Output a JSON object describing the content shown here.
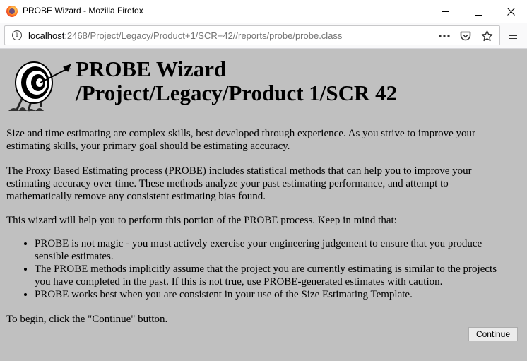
{
  "window": {
    "title": "PROBE Wizard - Mozilla Firefox",
    "minimize_glyph": "—",
    "maximize_glyph": "☐",
    "close_glyph": "✕"
  },
  "toolbar": {
    "url_host": "localhost",
    "url_path": ":2468/Project/Legacy/Product+1/SCR+42//reports/probe/probe.class",
    "page_actions": [
      "ellipsis-icon",
      "pocket-icon",
      "bookmark-star-icon"
    ],
    "menu": "hamburger-menu-icon"
  },
  "page": {
    "heading_line1": "PROBE Wizard",
    "heading_line2": "/Project/Legacy/Product 1/SCR 42",
    "para1": "Size and time estimating are complex skills, best developed through experience. As you strive to improve your estimating skills, your primary goal should be estimating accuracy.",
    "para2": "The Proxy Based Estimating process (PROBE) includes statistical methods that can help you to improve your estimating accuracy over time. These methods analyze your past estimating performance, and attempt to mathematically remove any consistent estimating bias found.",
    "para3": "This wizard will help you to perform this portion of the PROBE process. Keep in mind that:",
    "bullets": [
      "PROBE is not magic - you must actively exercise your engineering judgement to ensure that you produce sensible estimates.",
      "The PROBE methods implicitly assume that the project you are currently estimating is similar to the projects you have completed in the past. If this is not true, use PROBE-generated estimates with caution.",
      "PROBE works best when you are consistent in your use of the Size Estimating Template."
    ],
    "para4": "To begin, click the \"Continue\" button.",
    "continue_label": "Continue",
    "logo_icon": "target-arrow-icon"
  },
  "colors": {
    "page_background": "#c0c0c0",
    "chrome_background": "#f9f9fa"
  }
}
